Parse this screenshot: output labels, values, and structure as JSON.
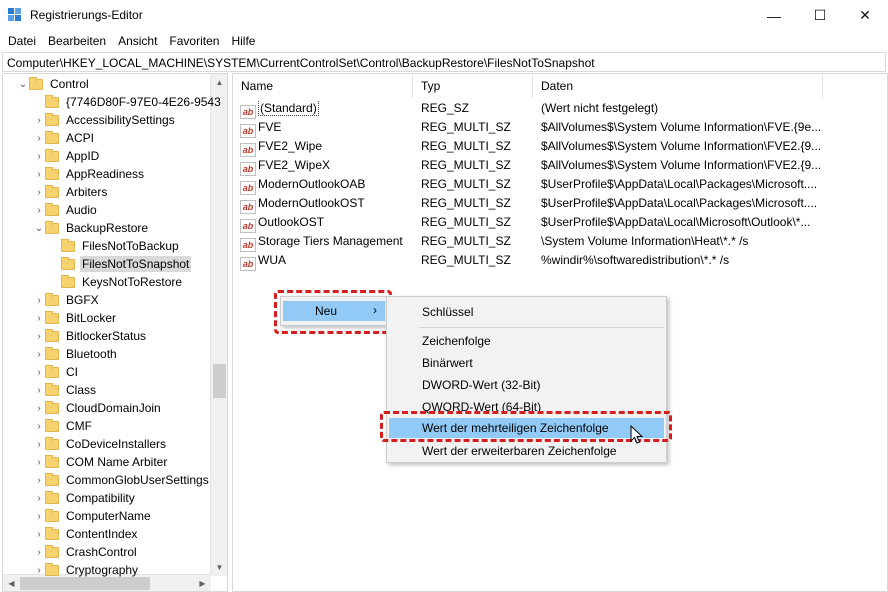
{
  "window": {
    "title": "Registrierungs-Editor",
    "minimize": "—",
    "maximize": "☐",
    "close": "✕"
  },
  "menubar": [
    "Datei",
    "Bearbeiten",
    "Ansicht",
    "Favoriten",
    "Hilfe"
  ],
  "address": "Computer\\HKEY_LOCAL_MACHINE\\SYSTEM\\CurrentControlSet\\Control\\BackupRestore\\FilesNotToSnapshot",
  "tree": {
    "items": [
      {
        "label": "Control",
        "expanded": true
      },
      {
        "label": "{7746D80F-97E0-4E26-9543"
      },
      {
        "label": "AccessibilitySettings"
      },
      {
        "label": "ACPI"
      },
      {
        "label": "AppID"
      },
      {
        "label": "AppReadiness"
      },
      {
        "label": "Arbiters"
      },
      {
        "label": "Audio"
      },
      {
        "label": "BackupRestore",
        "expanded": true
      },
      {
        "label": "FilesNotToBackup"
      },
      {
        "label": "FilesNotToSnapshot",
        "selected": true
      },
      {
        "label": "KeysNotToRestore"
      },
      {
        "label": "BGFX"
      },
      {
        "label": "BitLocker"
      },
      {
        "label": "BitlockerStatus"
      },
      {
        "label": "Bluetooth"
      },
      {
        "label": "CI"
      },
      {
        "label": "Class"
      },
      {
        "label": "CloudDomainJoin"
      },
      {
        "label": "CMF"
      },
      {
        "label": "CoDeviceInstallers"
      },
      {
        "label": "COM Name Arbiter"
      },
      {
        "label": "CommonGlobUserSettings"
      },
      {
        "label": "Compatibility"
      },
      {
        "label": "ComputerName"
      },
      {
        "label": "ContentIndex"
      },
      {
        "label": "CrashControl"
      },
      {
        "label": "Cryptography"
      }
    ]
  },
  "list": {
    "columns": [
      "Name",
      "Typ",
      "Daten"
    ],
    "rows": [
      {
        "name": "(Standard)",
        "type": "REG_SZ",
        "data": "(Wert nicht festgelegt)"
      },
      {
        "name": "FVE",
        "type": "REG_MULTI_SZ",
        "data": "$AllVolumes$\\System Volume Information\\FVE.{9e..."
      },
      {
        "name": "FVE2_Wipe",
        "type": "REG_MULTI_SZ",
        "data": "$AllVolumes$\\System Volume Information\\FVE2.{9..."
      },
      {
        "name": "FVE2_WipeX",
        "type": "REG_MULTI_SZ",
        "data": "$AllVolumes$\\System Volume Information\\FVE2.{9..."
      },
      {
        "name": "ModernOutlookOAB",
        "type": "REG_MULTI_SZ",
        "data": "$UserProfile$\\AppData\\Local\\Packages\\Microsoft...."
      },
      {
        "name": "ModernOutlookOST",
        "type": "REG_MULTI_SZ",
        "data": "$UserProfile$\\AppData\\Local\\Packages\\Microsoft...."
      },
      {
        "name": "OutlookOST",
        "type": "REG_MULTI_SZ",
        "data": "$UserProfile$\\AppData\\Local\\Microsoft\\Outlook\\*..."
      },
      {
        "name": "Storage Tiers Management",
        "type": "REG_MULTI_SZ",
        "data": "\\System Volume Information\\Heat\\*.* /s"
      },
      {
        "name": "WUA",
        "type": "REG_MULTI_SZ",
        "data": "%windir%\\softwaredistribution\\*.* /s"
      }
    ]
  },
  "context_menu": {
    "new_label": "Neu",
    "arrow": "›"
  },
  "submenu": {
    "items": [
      "Schlüssel",
      "Zeichenfolge",
      "Binärwert",
      "DWORD-Wert (32-Bit)",
      "QWORD-Wert (64-Bit)",
      "Wert der mehrteiligen Zeichenfolge",
      "Wert der erweiterbaren Zeichenfolge"
    ],
    "highlighted_index": 5
  },
  "icons": {
    "value_icon": "ab",
    "tree_expand": "›",
    "tree_collapse": "⌄"
  },
  "colors": {
    "highlight": "#91c9f7",
    "annotation": "#d61e1e",
    "folder": "#f7d36f"
  }
}
